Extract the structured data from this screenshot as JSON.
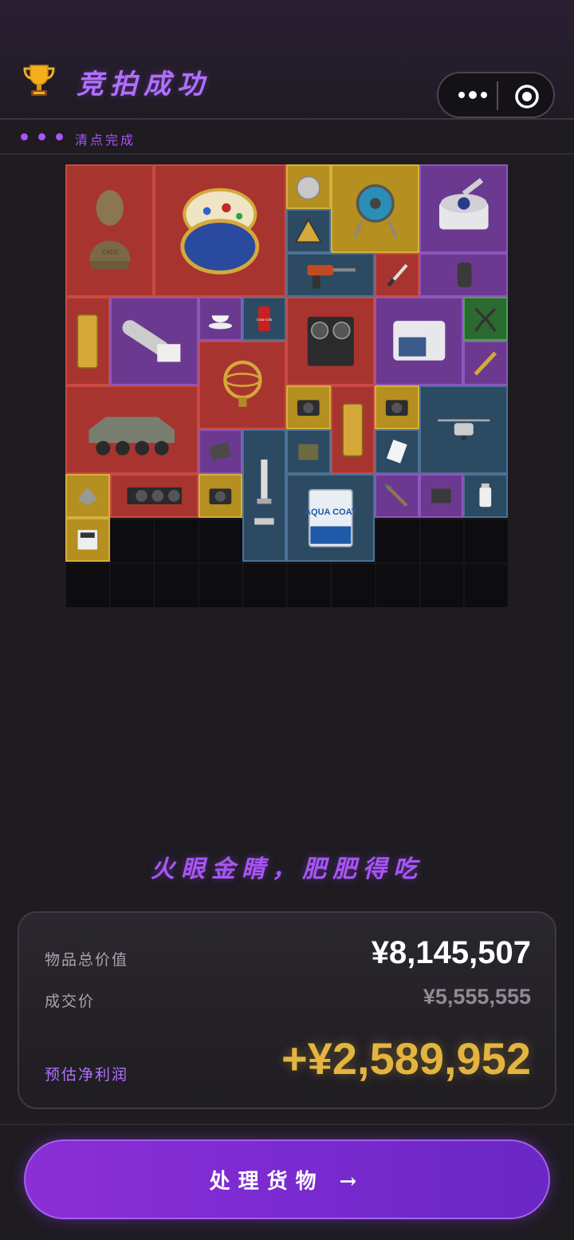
{
  "header": {
    "title": "竞拍成功",
    "trophy_icon": "trophy-icon",
    "menu_icon": "more-dots-icon",
    "close_icon": "target-circle-icon"
  },
  "status": {
    "label": "清点完成"
  },
  "inventory": {
    "items": [
      {
        "name": "bronze-bust",
        "rarity": "red"
      },
      {
        "name": "jeweled-egg",
        "rarity": "red"
      },
      {
        "name": "pocket-watch",
        "rarity": "yellow"
      },
      {
        "name": "cable-reel",
        "rarity": "yellow"
      },
      {
        "name": "centrifuge",
        "rarity": "purple"
      },
      {
        "name": "warning-sign",
        "rarity": "blue"
      },
      {
        "name": "power-drill",
        "rarity": "blue"
      },
      {
        "name": "pen-knife",
        "rarity": "red"
      },
      {
        "name": "dark-stone",
        "rarity": "purple"
      },
      {
        "name": "gold-bar",
        "rarity": "red"
      },
      {
        "name": "telescope-device",
        "rarity": "purple"
      },
      {
        "name": "teacup",
        "rarity": "purple"
      },
      {
        "name": "soda-can",
        "rarity": "blue"
      },
      {
        "name": "reel-tape-recorder",
        "rarity": "red"
      },
      {
        "name": "lab-incubator",
        "rarity": "purple"
      },
      {
        "name": "pliers",
        "rarity": "green"
      },
      {
        "name": "armillary-sphere",
        "rarity": "red"
      },
      {
        "name": "screwdriver",
        "rarity": "purple"
      },
      {
        "name": "armored-vehicle",
        "rarity": "red"
      },
      {
        "name": "camera",
        "rarity": "yellow"
      },
      {
        "name": "gold-bar",
        "rarity": "red"
      },
      {
        "name": "camera",
        "rarity": "yellow"
      },
      {
        "name": "drone",
        "rarity": "blue"
      },
      {
        "name": "circuit-chip",
        "rarity": "purple"
      },
      {
        "name": "microscope",
        "rarity": "blue"
      },
      {
        "name": "ammo-box",
        "rarity": "blue"
      },
      {
        "name": "sd-card",
        "rarity": "blue"
      },
      {
        "name": "mech-part",
        "rarity": "yellow"
      },
      {
        "name": "graphics-card",
        "rarity": "red"
      },
      {
        "name": "camera",
        "rarity": "yellow"
      },
      {
        "name": "paint-can",
        "rarity": "blue"
      },
      {
        "name": "spear-head",
        "rarity": "purple"
      },
      {
        "name": "circuit-board",
        "rarity": "purple"
      },
      {
        "name": "medicine-bottle",
        "rarity": "blue"
      },
      {
        "name": "meter-device",
        "rarity": "yellow"
      }
    ],
    "paint_can_text": "AQUA COAT",
    "soda_text": "Coca-Cola",
    "bust_text": "CATO"
  },
  "slogan": "火眼金睛，肥肥得吃",
  "summary": {
    "total_label": "物品总价值",
    "total_value": "¥8,145,507",
    "deal_label": "成交价",
    "deal_value": "¥5,555,555",
    "profit_label": "预估净利润",
    "profit_value": "+¥2,589,952"
  },
  "action": {
    "label": "处理货物 →"
  },
  "colors": {
    "accent_purple": "#a855f7",
    "profit_gold": "#e3b43f",
    "rarity_red": "#a8342f",
    "rarity_purple": "#6b3a90",
    "rarity_yellow": "#b58f1f",
    "rarity_blue": "#2d4a63",
    "rarity_green": "#2b6a30"
  }
}
